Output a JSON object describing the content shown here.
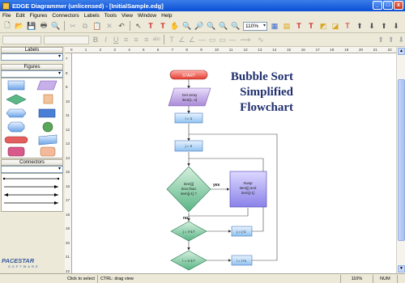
{
  "window": {
    "title": "EDGE Diagrammer (unlicensed) - [InitialSample.edg]",
    "min": "_",
    "max": "□",
    "close": "x"
  },
  "menu": [
    "File",
    "Edit",
    "Figures",
    "Connectors",
    "Labels",
    "Tools",
    "View",
    "Window",
    "Help"
  ],
  "toolbar": {
    "zoom": "110%"
  },
  "panels": {
    "labels": "Labels",
    "figures": "Figures",
    "connectors": "Connectors"
  },
  "brand": {
    "name": "PACESTAR",
    "sub": "SOFTWARE"
  },
  "diagram": {
    "title_lines": [
      "Bubble Sort",
      "Simplified",
      "Flowchart"
    ],
    "start": "START",
    "get_array": [
      "Get array",
      "item[1..n]"
    ],
    "i_init": "i = 1",
    "j_init": "j = n",
    "decision": [
      "item[j]",
      "less than",
      "item[j-1] ?"
    ],
    "swap": [
      "Swap",
      "item[j] and",
      "item[j-1]"
    ],
    "yes": "yes",
    "no": "no",
    "j_check": "j = i+1?",
    "j_dec": "j = j-1",
    "i_check": "i = n-1?",
    "i_inc": "i = i+1"
  },
  "ruler": {
    "h": [
      "0",
      "1",
      "2",
      "3",
      "4",
      "5",
      "6",
      "7",
      "8",
      "9",
      "10",
      "11",
      "12",
      "13",
      "14",
      "15",
      "16",
      "17",
      "18",
      "19",
      "20",
      "21",
      "22"
    ],
    "v": [
      "7",
      "8",
      "9",
      "10",
      "11",
      "12",
      "13",
      "14",
      "15",
      "16",
      "17",
      "18",
      "19",
      "20",
      "21",
      "22"
    ]
  },
  "status": {
    "hint1": "Click to select",
    "hint2": "CTRL: drag view",
    "zoom": "110%",
    "num": "NUM"
  }
}
